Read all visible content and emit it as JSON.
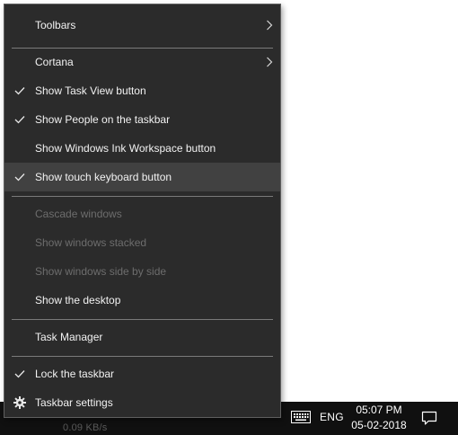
{
  "menu": {
    "items": [
      {
        "label": "Toolbars",
        "checked": false,
        "disabled": false,
        "submenu": true,
        "icon": "none"
      },
      {
        "label": "Cortana",
        "checked": false,
        "disabled": false,
        "submenu": true,
        "icon": "none"
      },
      {
        "label": "Show Task View button",
        "checked": true,
        "disabled": false,
        "submenu": false,
        "icon": "checkmark-icon"
      },
      {
        "label": "Show People on the taskbar",
        "checked": true,
        "disabled": false,
        "submenu": false,
        "icon": "checkmark-icon"
      },
      {
        "label": "Show Windows Ink Workspace button",
        "checked": false,
        "disabled": false,
        "submenu": false,
        "icon": "none"
      },
      {
        "label": "Show touch keyboard button",
        "checked": true,
        "disabled": false,
        "submenu": false,
        "icon": "checkmark-icon",
        "highlighted": true
      },
      {
        "label": "Cascade windows",
        "checked": false,
        "disabled": true,
        "submenu": false,
        "icon": "none"
      },
      {
        "label": "Show windows stacked",
        "checked": false,
        "disabled": true,
        "submenu": false,
        "icon": "none"
      },
      {
        "label": "Show windows side by side",
        "checked": false,
        "disabled": true,
        "submenu": false,
        "icon": "none"
      },
      {
        "label": "Show the desktop",
        "checked": false,
        "disabled": false,
        "submenu": false,
        "icon": "none"
      },
      {
        "label": "Task Manager",
        "checked": false,
        "disabled": false,
        "submenu": false,
        "icon": "none"
      },
      {
        "label": "Lock the taskbar",
        "checked": true,
        "disabled": false,
        "submenu": false,
        "icon": "checkmark-icon"
      },
      {
        "label": "Taskbar settings",
        "checked": false,
        "disabled": false,
        "submenu": false,
        "icon": "gear-icon"
      }
    ]
  },
  "taskbar": {
    "partial_text": "0.09 KB/s",
    "input_language": "ENG",
    "clock_time": "05:07 PM",
    "clock_date": "05-02-2018",
    "keyboard_icon": "touch-keyboard-icon",
    "notification_icon": "action-center-icon"
  },
  "colors": {
    "menu_background": "#2b2b2b",
    "menu_border": "#5f5f5f",
    "highlight": "#414141",
    "text": "#f2f2f2",
    "disabled_text": "#6d6d6d",
    "separator": "#7a7a7a",
    "taskbar": "#101010"
  }
}
